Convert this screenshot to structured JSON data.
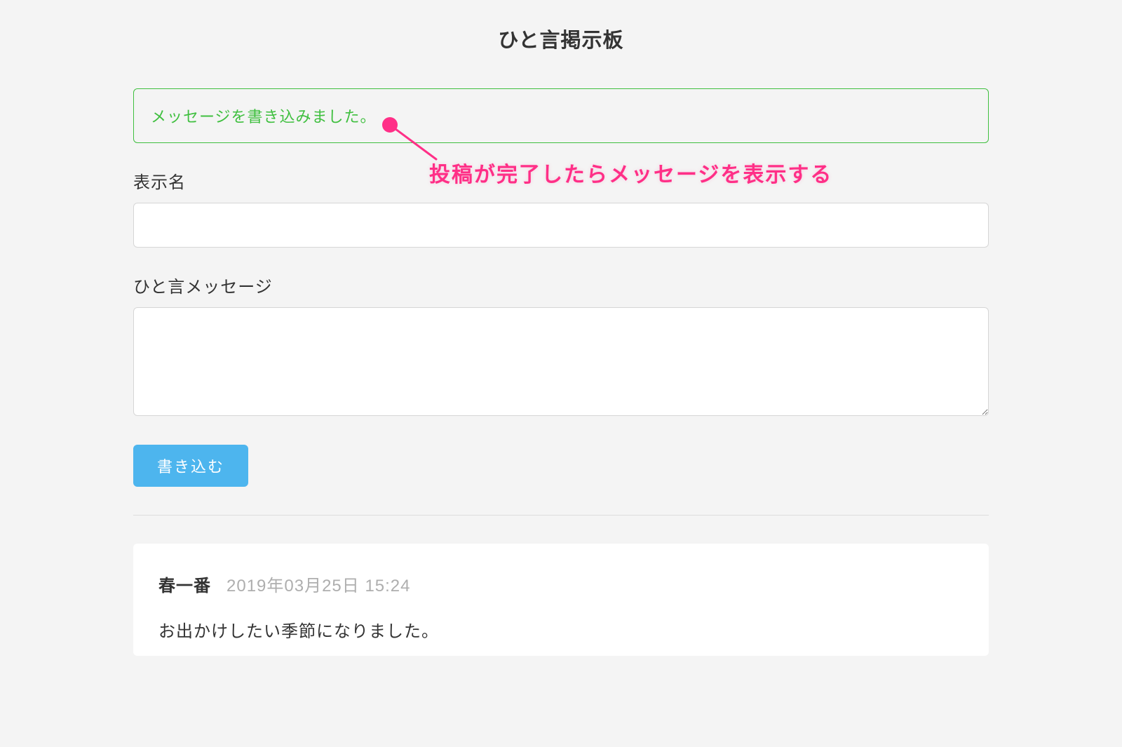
{
  "page": {
    "title": "ひと言掲示板"
  },
  "alert": {
    "success_text": "メッセージを書き込みました。"
  },
  "annotation": {
    "text": "投稿が完了したらメッセージを表示する"
  },
  "form": {
    "display_name_label": "表示名",
    "display_name_value": "",
    "message_label": "ひと言メッセージ",
    "message_value": "",
    "submit_label": "書き込む"
  },
  "posts": [
    {
      "author": "春一番",
      "timestamp": "2019年03月25日 15:24",
      "body": "お出かけしたい季節になりました。"
    }
  ]
}
